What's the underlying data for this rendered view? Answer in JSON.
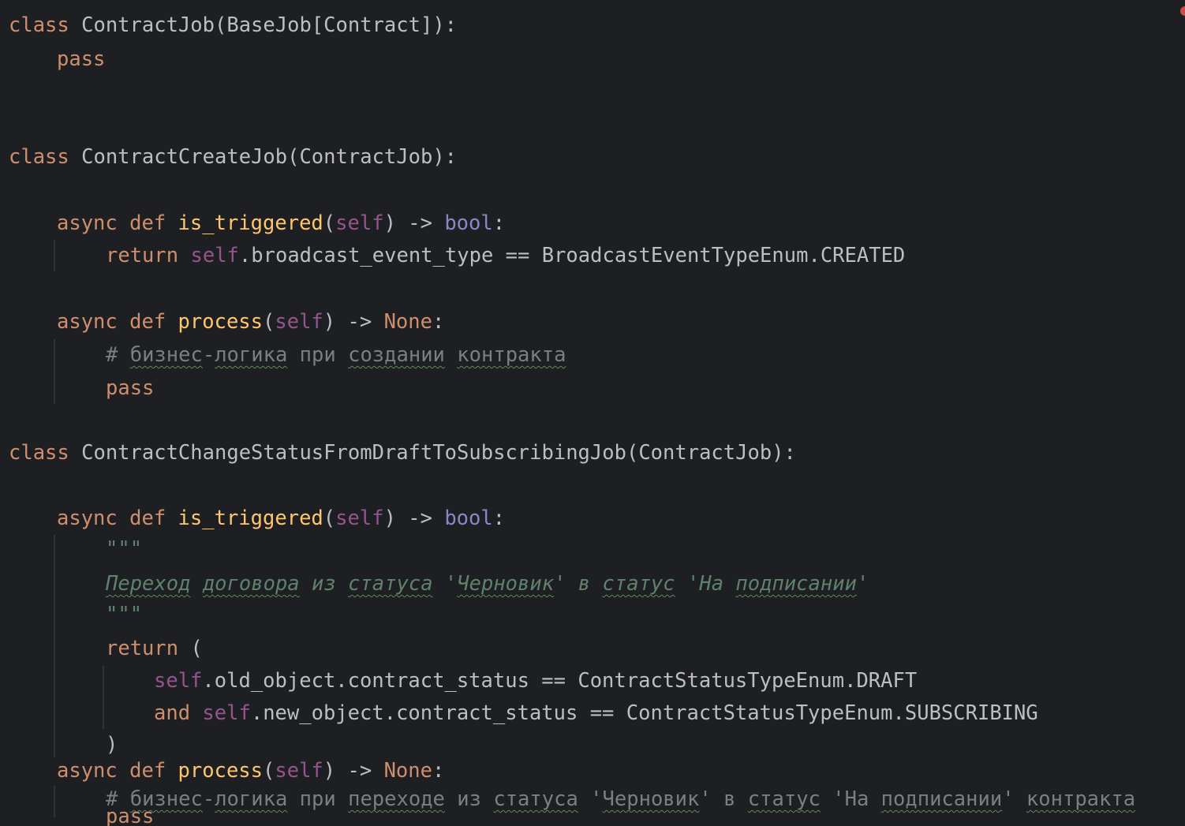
{
  "editor": {
    "language": "python",
    "theme": {
      "background": "#1e1f22",
      "keyword": "#cf8e6d",
      "function": "#ffc66d",
      "self": "#94558d",
      "builtin": "#8888c6",
      "comment": "#7a7e85",
      "docstring": "#5f826b",
      "text": "#bcbec4",
      "error_marker": "#c94f4f"
    },
    "lines": {
      "l1": {
        "t1": "class",
        "t2": " ContractJob(BaseJob[Contract]):"
      },
      "l2": {
        "t1": "pass"
      },
      "l3": {
        "t1": "class",
        "t2": " ContractCreateJob(ContractJob):"
      },
      "l4": {
        "t1": "async",
        "t2": " ",
        "t3": "def",
        "t4": " ",
        "t5": "is_triggered",
        "t6": "(",
        "t7": "self",
        "t8": ") -> ",
        "t9": "bool",
        "t10": ":"
      },
      "l5": {
        "t1": "return",
        "t2": " ",
        "t3": "self",
        "t4": ".broadcast_event_type == BroadcastEventTypeEnum.CREATED"
      },
      "l6": {
        "t1": "async",
        "t2": " ",
        "t3": "def",
        "t4": " ",
        "t5": "process",
        "t6": "(",
        "t7": "self",
        "t8": ") -> ",
        "t9": "None",
        "t10": ":"
      },
      "l7": {
        "t1": "# ",
        "t2": "бизнес",
        "t3": "-",
        "t4": "логика",
        "t5": " при ",
        "t6": "создании",
        "t7": " ",
        "t8": "контракта"
      },
      "l8": {
        "t1": "pass"
      },
      "l9": {
        "t1": "class",
        "t2": " ContractChangeStatusFromDraftToSubscribingJob(ContractJob):"
      },
      "l10": {
        "t1": "async",
        "t2": " ",
        "t3": "def",
        "t4": " ",
        "t5": "is_triggered",
        "t6": "(",
        "t7": "self",
        "t8": ") -> ",
        "t9": "bool",
        "t10": ":"
      },
      "l11": {
        "t1": "\"\"\""
      },
      "l12": {
        "t1": "Переход",
        "t2": " ",
        "t3": "договора",
        "t4": " из ",
        "t5": "статуса",
        "t6": " '",
        "t7": "Черновик",
        "t8": "' в ",
        "t9": "статус",
        "t10": " 'На ",
        "t11": "подписании",
        "t12": "'"
      },
      "l13": {
        "t1": "\"\"\""
      },
      "l14": {
        "t1": "return",
        "t2": " ("
      },
      "l15": {
        "t1": "self",
        "t2": ".old_object.contract_status == ContractStatusTypeEnum.DRAFT"
      },
      "l16": {
        "t1": "and",
        "t2": " ",
        "t3": "self",
        "t4": ".new_object.contract_status == ContractStatusTypeEnum.SUBSCRIBING"
      },
      "l17": {
        "t1": ")"
      },
      "l18": {
        "t1": "async",
        "t2": " ",
        "t3": "def",
        "t4": " ",
        "t5": "process",
        "t6": "(",
        "t7": "self",
        "t8": ") -> ",
        "t9": "None",
        "t10": ":"
      },
      "l19": {
        "t1": "# ",
        "t2": "бизнес",
        "t3": "-",
        "t4": "логика",
        "t5": " при ",
        "t6": "переходе",
        "t7": " из ",
        "t8": "статуса",
        "t9": " '",
        "t10": "Черновик",
        "t11": "' в ",
        "t12": "статус",
        "t13": " 'На ",
        "t14": "подписании",
        "t15": "' ",
        "t16": "контракта"
      },
      "l20": {
        "t1": "pass"
      }
    }
  }
}
